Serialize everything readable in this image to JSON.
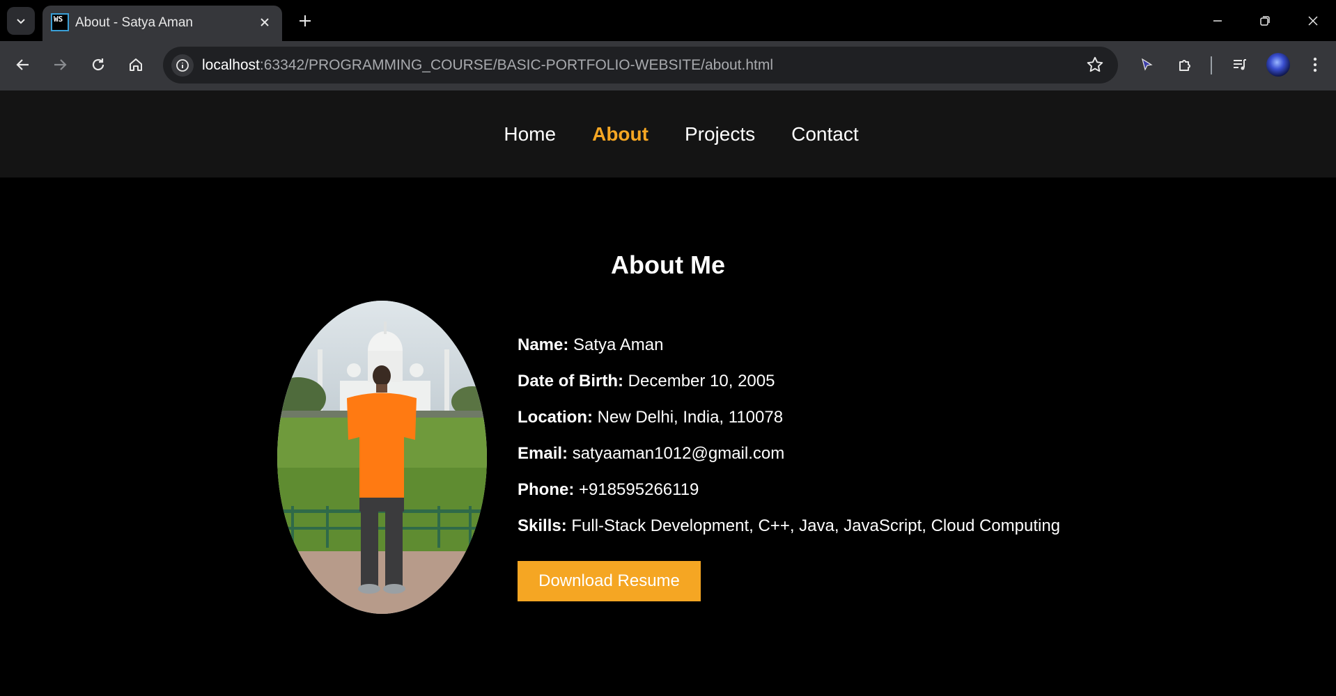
{
  "browser": {
    "tab_title": "About - Satya Aman",
    "favicon_text": "WS",
    "url_host": "localhost",
    "url_rest": ":63342/PROGRAMMING_COURSE/BASIC-PORTFOLIO-WEBSITE/about.html"
  },
  "nav": {
    "items": [
      "Home",
      "About",
      "Projects",
      "Contact"
    ],
    "active": "About",
    "active_color": "#f5a623"
  },
  "about": {
    "title": "About Me",
    "rows": [
      {
        "label": "Name:",
        "value": "Satya Aman"
      },
      {
        "label": "Date of Birth:",
        "value": "December 10, 2005"
      },
      {
        "label": "Location:",
        "value": "New Delhi, India, 110078"
      },
      {
        "label": "Email:",
        "value": "satyaaman1012@gmail.com"
      },
      {
        "label": "Phone:",
        "value": "+918595266119"
      },
      {
        "label": "Skills:",
        "value": "Full-Stack Development, C++, Java, JavaScript, Cloud Computing"
      }
    ],
    "button_label": "Download Resume",
    "button_color": "#f5a623"
  }
}
